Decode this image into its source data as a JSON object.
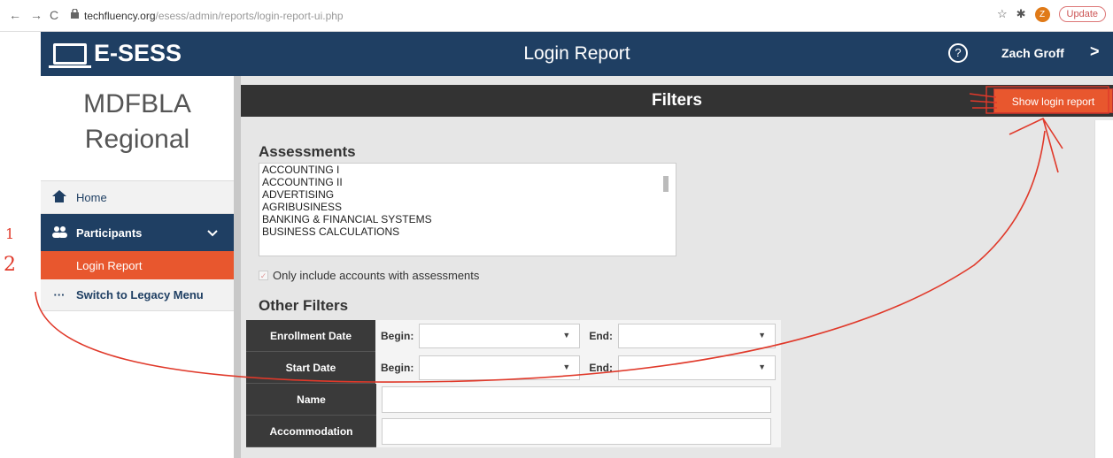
{
  "browser": {
    "url_host": "techfluency.org",
    "url_path": "/esess/admin/reports/login-report-ui.php",
    "avatar_letter": "Z",
    "update_label": "Update"
  },
  "header": {
    "brand": "E-SESS",
    "title": "Login Report",
    "help_label": "?",
    "user": "Zach Groff",
    "user_chevron": ">"
  },
  "sidebar": {
    "org_line1": "MDFBLA",
    "org_line2": "Regional",
    "items": [
      {
        "label": "Home",
        "icon": "home-icon"
      },
      {
        "label": "Participants",
        "icon": "users-icon"
      },
      {
        "label": "Login Report"
      },
      {
        "label": "Switch to Legacy Menu",
        "icon": "dots-icon"
      }
    ]
  },
  "filters": {
    "title": "Filters",
    "show_button": "Show login report",
    "assessments_title": "Assessments",
    "assessments": [
      "ACCOUNTING I",
      "ACCOUNTING II",
      "ADVERTISING",
      "AGRIBUSINESS",
      "BANKING & FINANCIAL SYSTEMS",
      "BUSINESS CALCULATIONS"
    ],
    "only_accounts_label": "Only include accounts with assessments",
    "other_title": "Other Filters",
    "enrollment_label": "Enrollment Date",
    "start_label": "Start Date",
    "name_label": "Name",
    "accommodation_label": "Accommodation",
    "begin_label": "Begin:",
    "end_label": "End:"
  },
  "annotations": {
    "step1": "1",
    "step2": "2"
  },
  "colors": {
    "header": "#1f3f63",
    "accent": "#e8572e",
    "annotation": "#e0392a"
  }
}
